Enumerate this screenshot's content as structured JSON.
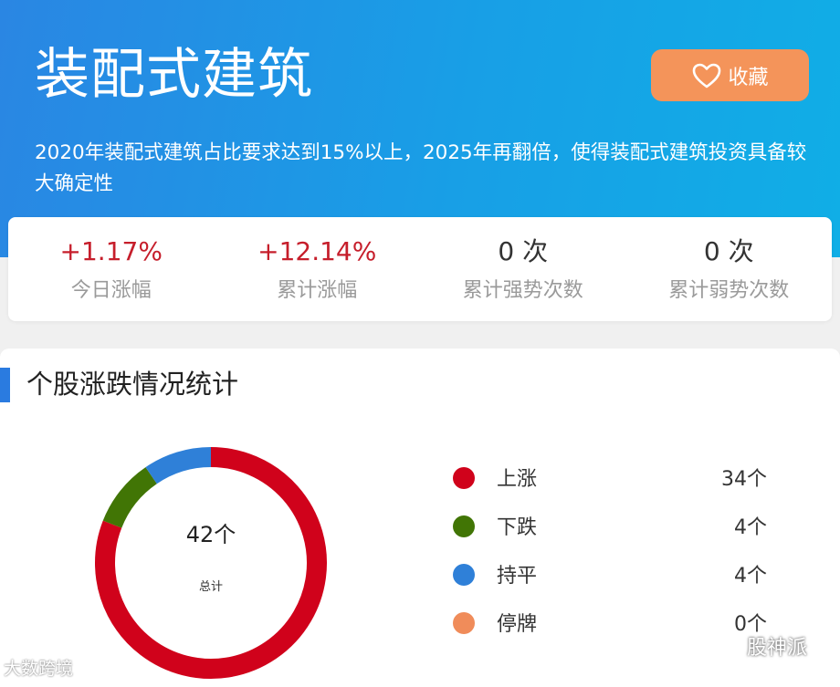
{
  "header": {
    "title": "装配式建筑",
    "favorite_label": "收藏",
    "description": "2020年装配式建筑占比要求达到15%以上，2025年再翻倍，使得装配式建筑投资具备较大确定性"
  },
  "stats": [
    {
      "value": "+1.17%",
      "label": "今日涨幅",
      "color": "#c61e2b"
    },
    {
      "value": "+12.14%",
      "label": "累计涨幅",
      "color": "#c61e2b"
    },
    {
      "value": "0 次",
      "label": "累计强势次数",
      "color": "#333333"
    },
    {
      "value": "0 次",
      "label": "累计弱势次数",
      "color": "#333333"
    }
  ],
  "section": {
    "title": "个股涨跌情况统计"
  },
  "chart_data": {
    "type": "pie",
    "center_total": "42个",
    "center_label": "总计",
    "slices": [
      {
        "label": "上涨",
        "value": 34,
        "count_text": "34个",
        "color": "#d0021b"
      },
      {
        "label": "下跌",
        "value": 4,
        "count_text": "4个",
        "color": "#417505"
      },
      {
        "label": "持平",
        "value": 4,
        "count_text": "4个",
        "color": "#2f80d8"
      },
      {
        "label": "停牌",
        "value": 0,
        "count_text": "0个",
        "color": "#f08c5a"
      }
    ]
  },
  "watermarks": {
    "left": "大数跨境",
    "right": "股神派"
  }
}
